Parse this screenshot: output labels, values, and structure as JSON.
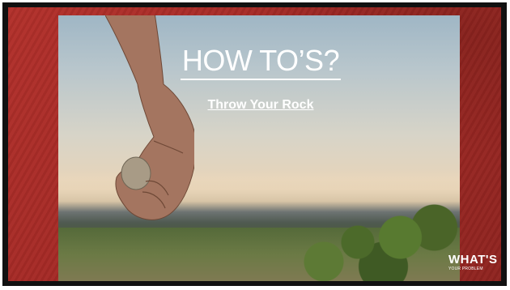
{
  "slide": {
    "title": "HOW TO’S?",
    "subtitle": "Throw Your Rock"
  },
  "logo": {
    "main": "WHAT'S",
    "sub": "YOUR PROBLEM"
  },
  "colors": {
    "background_red": "#a52a26",
    "frame": "#111111",
    "text": "#ffffff"
  },
  "image": {
    "subject": "hand holding a rock over a field at sunset"
  }
}
